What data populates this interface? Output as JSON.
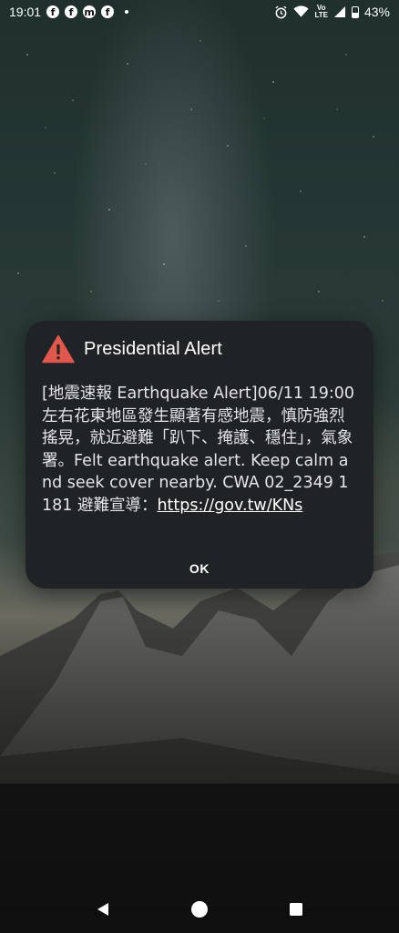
{
  "status_bar": {
    "time": "19:01",
    "notification_icons": [
      "facebook-icon",
      "facebook-icon",
      "facebook-messenger-icon",
      "facebook-icon"
    ],
    "volte_label_top": "Vo",
    "volte_label_bottom": "LTE",
    "battery_percent": "43%"
  },
  "dialog": {
    "title": "Presidential Alert",
    "icon": "warning-triangle-icon",
    "icon_color": "#e2574c",
    "body_text": "[地震速報 Earthquake Alert]06/11 19:00 左右花東地區發生顯著有感地震，慎防強烈搖晃，就近避難「趴下、掩護、穩住」，氣象署。Felt earthquake alert. Keep calm and seek cover nearby. CWA 02_2349 1181 避難宣導：",
    "link_text": "https://gov.tw/KNs",
    "ok_label": "OK"
  },
  "nav_bar": {
    "back": "back-triangle-icon",
    "home": "home-circle-icon",
    "recents": "recents-square-icon"
  }
}
